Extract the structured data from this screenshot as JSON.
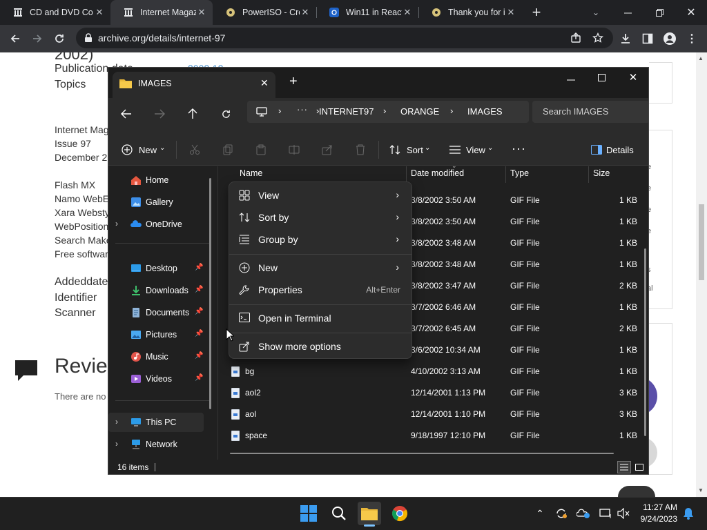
{
  "browser": {
    "tabs": [
      {
        "title": "CD and DVD Co",
        "active": false,
        "icon": "archive-icon"
      },
      {
        "title": "Internet Magazi",
        "active": true,
        "icon": "archive-icon"
      },
      {
        "title": "PowerISO - Crea",
        "active": false,
        "icon": "disc-icon"
      },
      {
        "title": "Win11 in React",
        "active": false,
        "icon": "react-icon"
      },
      {
        "title": "Thank you for i",
        "active": false,
        "icon": "disc-icon"
      }
    ],
    "url": "archive.org/details/internet-97"
  },
  "page": {
    "year_fragment": "2002)",
    "publication_label": "Publication date",
    "publication_value": "2002-12",
    "topics_label": "Topics",
    "desc_lines": [
      "Internet Mag",
      "Issue 97",
      "December 2"
    ],
    "software_lines": [
      "Flash MX",
      "Namo WebE",
      "Xara Websty",
      "WebPosition",
      "Search Make",
      "Free softwar"
    ],
    "meta_lines": [
      "Addeddate",
      "Identifier",
      "Scanner"
    ],
    "reviews_heading": "Revie",
    "reviews_text": "There are no",
    "right_edge_chars": [
      "e",
      "e",
      "e",
      "e",
      "s",
      "al"
    ]
  },
  "explorer": {
    "tab_title": "IMAGES",
    "breadcrumb": [
      "INTERNET97",
      "ORANGE",
      "IMAGES"
    ],
    "search_placeholder": "Search IMAGES",
    "commands": {
      "new": "New",
      "sort": "Sort",
      "view": "View",
      "details": "Details"
    },
    "nav": [
      {
        "label": "Home",
        "icon": "home-icon",
        "pinned": false,
        "expandable": false
      },
      {
        "label": "Gallery",
        "icon": "gallery-icon",
        "pinned": false,
        "expandable": false
      },
      {
        "label": "OneDrive",
        "icon": "cloud-icon",
        "pinned": false,
        "expandable": true
      },
      {
        "label": "Desktop",
        "icon": "desktop-icon",
        "pinned": true,
        "expandable": false
      },
      {
        "label": "Downloads",
        "icon": "download-icon",
        "pinned": true,
        "expandable": false
      },
      {
        "label": "Documents",
        "icon": "document-icon",
        "pinned": true,
        "expandable": false
      },
      {
        "label": "Pictures",
        "icon": "picture-icon",
        "pinned": true,
        "expandable": false
      },
      {
        "label": "Music",
        "icon": "music-icon",
        "pinned": true,
        "expandable": false
      },
      {
        "label": "Videos",
        "icon": "video-icon",
        "pinned": true,
        "expandable": false
      },
      {
        "label": "This PC",
        "icon": "pc-icon",
        "pinned": false,
        "expandable": true
      },
      {
        "label": "Network",
        "icon": "network-icon",
        "pinned": false,
        "expandable": true
      }
    ],
    "columns": {
      "name": "Name",
      "date": "Date modified",
      "type": "Type",
      "size": "Size"
    },
    "rows": [
      {
        "name": "",
        "date": "3/8/2002 3:50 AM",
        "type": "GIF File",
        "size": "1 KB"
      },
      {
        "name": "",
        "date": "3/8/2002 3:50 AM",
        "type": "GIF File",
        "size": "1 KB"
      },
      {
        "name": "",
        "date": "3/8/2002 3:48 AM",
        "type": "GIF File",
        "size": "1 KB"
      },
      {
        "name": "",
        "date": "3/8/2002 3:48 AM",
        "type": "GIF File",
        "size": "1 KB"
      },
      {
        "name": "",
        "date": "3/8/2002 3:47 AM",
        "type": "GIF File",
        "size": "2 KB"
      },
      {
        "name": "",
        "date": "3/7/2002 6:46 AM",
        "type": "GIF File",
        "size": "1 KB"
      },
      {
        "name": "",
        "date": "3/7/2002 6:45 AM",
        "type": "GIF File",
        "size": "2 KB"
      },
      {
        "name": "",
        "date": "3/6/2002 10:34 AM",
        "type": "GIF File",
        "size": "1 KB"
      },
      {
        "name": "bg",
        "date": "4/10/2002 3:13 AM",
        "type": "GIF File",
        "size": "1 KB"
      },
      {
        "name": "aol2",
        "date": "12/14/2001 1:13 PM",
        "type": "GIF File",
        "size": "3 KB"
      },
      {
        "name": "aol",
        "date": "12/14/2001 1:10 PM",
        "type": "GIF File",
        "size": "3 KB"
      },
      {
        "name": "space",
        "date": "9/18/1997 12:10 PM",
        "type": "GIF File",
        "size": "1 KB"
      }
    ],
    "status": "16 items",
    "context_menu": {
      "items": [
        {
          "label": "View",
          "icon": "grid-icon",
          "submenu": true
        },
        {
          "label": "Sort by",
          "icon": "sort-icon",
          "submenu": true
        },
        {
          "label": "Group by",
          "icon": "group-icon",
          "submenu": true
        },
        {
          "label": "New",
          "icon": "plus-circle-icon",
          "submenu": true
        },
        {
          "label": "Properties",
          "icon": "wrench-icon",
          "shortcut": "Alt+Enter"
        },
        {
          "label": "Open in Terminal",
          "icon": "terminal-icon"
        },
        {
          "label": "Show more options",
          "icon": "share-icon"
        }
      ]
    }
  },
  "taskbar": {
    "time": "11:27 AM",
    "date": "9/24/2023"
  }
}
